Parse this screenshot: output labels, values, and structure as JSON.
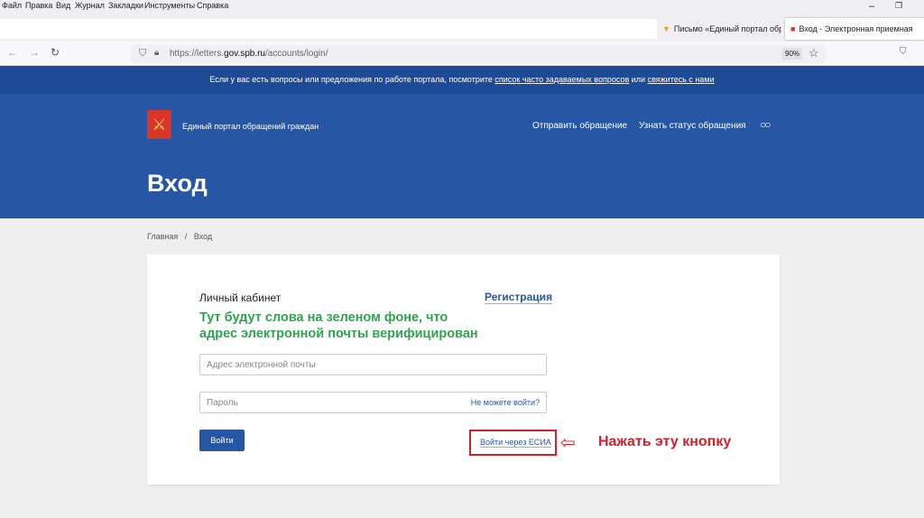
{
  "menu": [
    "Файл",
    "Правка",
    "Вид",
    "Журнал",
    "Закладки",
    "Инструменты",
    "Справка"
  ],
  "tabs": [
    {
      "label": "Письмо «Единый портал обр"
    },
    {
      "label": "Вход - Электронная приемная"
    }
  ],
  "url": {
    "prefix": "https://letters.",
    "domain": "gov.spb.ru",
    "path": "/accounts/login/"
  },
  "zoom": "90%",
  "info": {
    "text": "Если у вас есть вопросы или предложения по работе портала, посмотрите ",
    "link1": "список часто задаваемых вопросов",
    "mid": " или ",
    "link2": "свяжитесь с нами"
  },
  "header": {
    "site_name": "Единый портал обращений граждан",
    "nav": [
      "Отправить обращение",
      "Узнать статус обращения"
    ],
    "title": "Вход"
  },
  "breadcrumb": [
    "Главная",
    "/",
    "Вход"
  ],
  "form": {
    "title": "Личный кабинет",
    "register": "Регистрация",
    "notice": "Тут будут слова на зеленом фоне, что адрес электронной почты верифицирован",
    "email_placeholder": "Адрес электронной почты",
    "password_placeholder": "Пароль",
    "forgot": "Не можете войти?",
    "login": "Войти",
    "esia": "Войти через ЕСИА"
  },
  "annotation": "Нажать эту кнопку",
  "colors": {
    "brand": "#2756a5",
    "green": "#2ea44f",
    "annotation": "#d0202a"
  }
}
